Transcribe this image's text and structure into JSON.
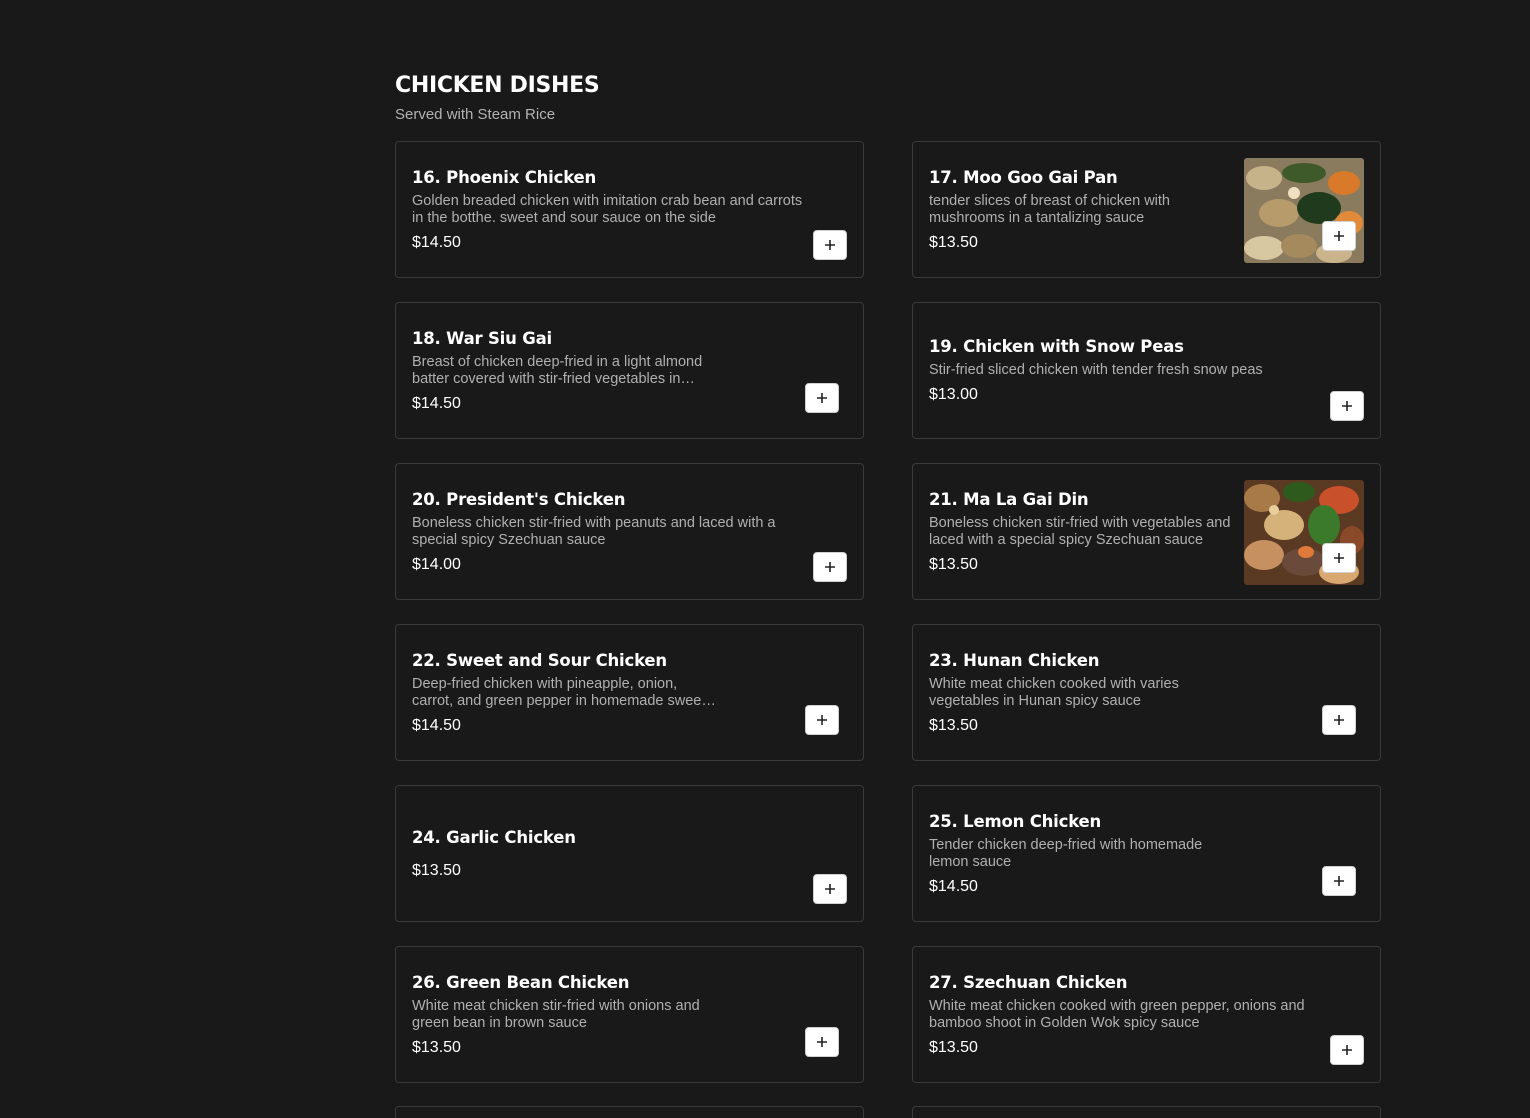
{
  "section": {
    "title": "CHICKEN DISHES",
    "subtitle": "Served with Steam Rice"
  },
  "items": [
    {
      "name": "16. Phoenix Chicken",
      "description": "Golden breaded chicken with imitation crab bean and carrots in the botthe. sweet and sour sauce on the side",
      "price": "$14.50"
    },
    {
      "name": "17. Moo Goo Gai Pan",
      "description": "tender slices of breast of chicken with mushrooms in a tantalizing sauce",
      "price": "$13.50"
    },
    {
      "name": "18. War Siu Gai",
      "description": "Breast of chicken deep-fried in a light almond batter covered with stir-fried vegetables in brown sauce",
      "price": "$14.50"
    },
    {
      "name": "19. Chicken with Snow Peas",
      "description": "Stir-fried sliced chicken with tender fresh snow peas",
      "price": "$13.00"
    },
    {
      "name": "20. President's Chicken",
      "description": "Boneless chicken stir-fried with peanuts and laced with a special spicy Szechuan sauce",
      "price": "$14.00"
    },
    {
      "name": "21. Ma La Gai Din",
      "description": "Boneless chicken stir-fried with vegetables and laced with a special spicy Szechuan sauce",
      "price": "$13.50"
    },
    {
      "name": "22. Sweet and Sour Chicken",
      "description": "Deep-fried chicken with pineapple, onion, carrot, and green pepper in homemade sweet and sour sauce",
      "price": "$14.50"
    },
    {
      "name": "23. Hunan Chicken",
      "description": "White meat chicken cooked with varies vegetables in Hunan spicy sauce",
      "price": "$13.50"
    },
    {
      "name": "24. Garlic Chicken",
      "description": "",
      "price": "$13.50"
    },
    {
      "name": "25. Lemon Chicken",
      "description": "Tender chicken deep-fried with homemade lemon sauce",
      "price": "$14.50"
    },
    {
      "name": "26. Green Bean Chicken",
      "description": "White meat chicken stir-fried with onions and green bean in brown sauce",
      "price": "$13.50"
    },
    {
      "name": "27. Szechuan Chicken",
      "description": "White meat chicken cooked with green pepper, onions and bamboo shoot in Golden Wok spicy sauce",
      "price": "$13.50"
    }
  ],
  "icons": {
    "add": "plus-icon"
  },
  "colors": {
    "background": "#191919",
    "card_border": "#3a3a3a",
    "text_primary": "#ffffff",
    "text_secondary": "#b0b0b0",
    "button": "#ffffff"
  }
}
